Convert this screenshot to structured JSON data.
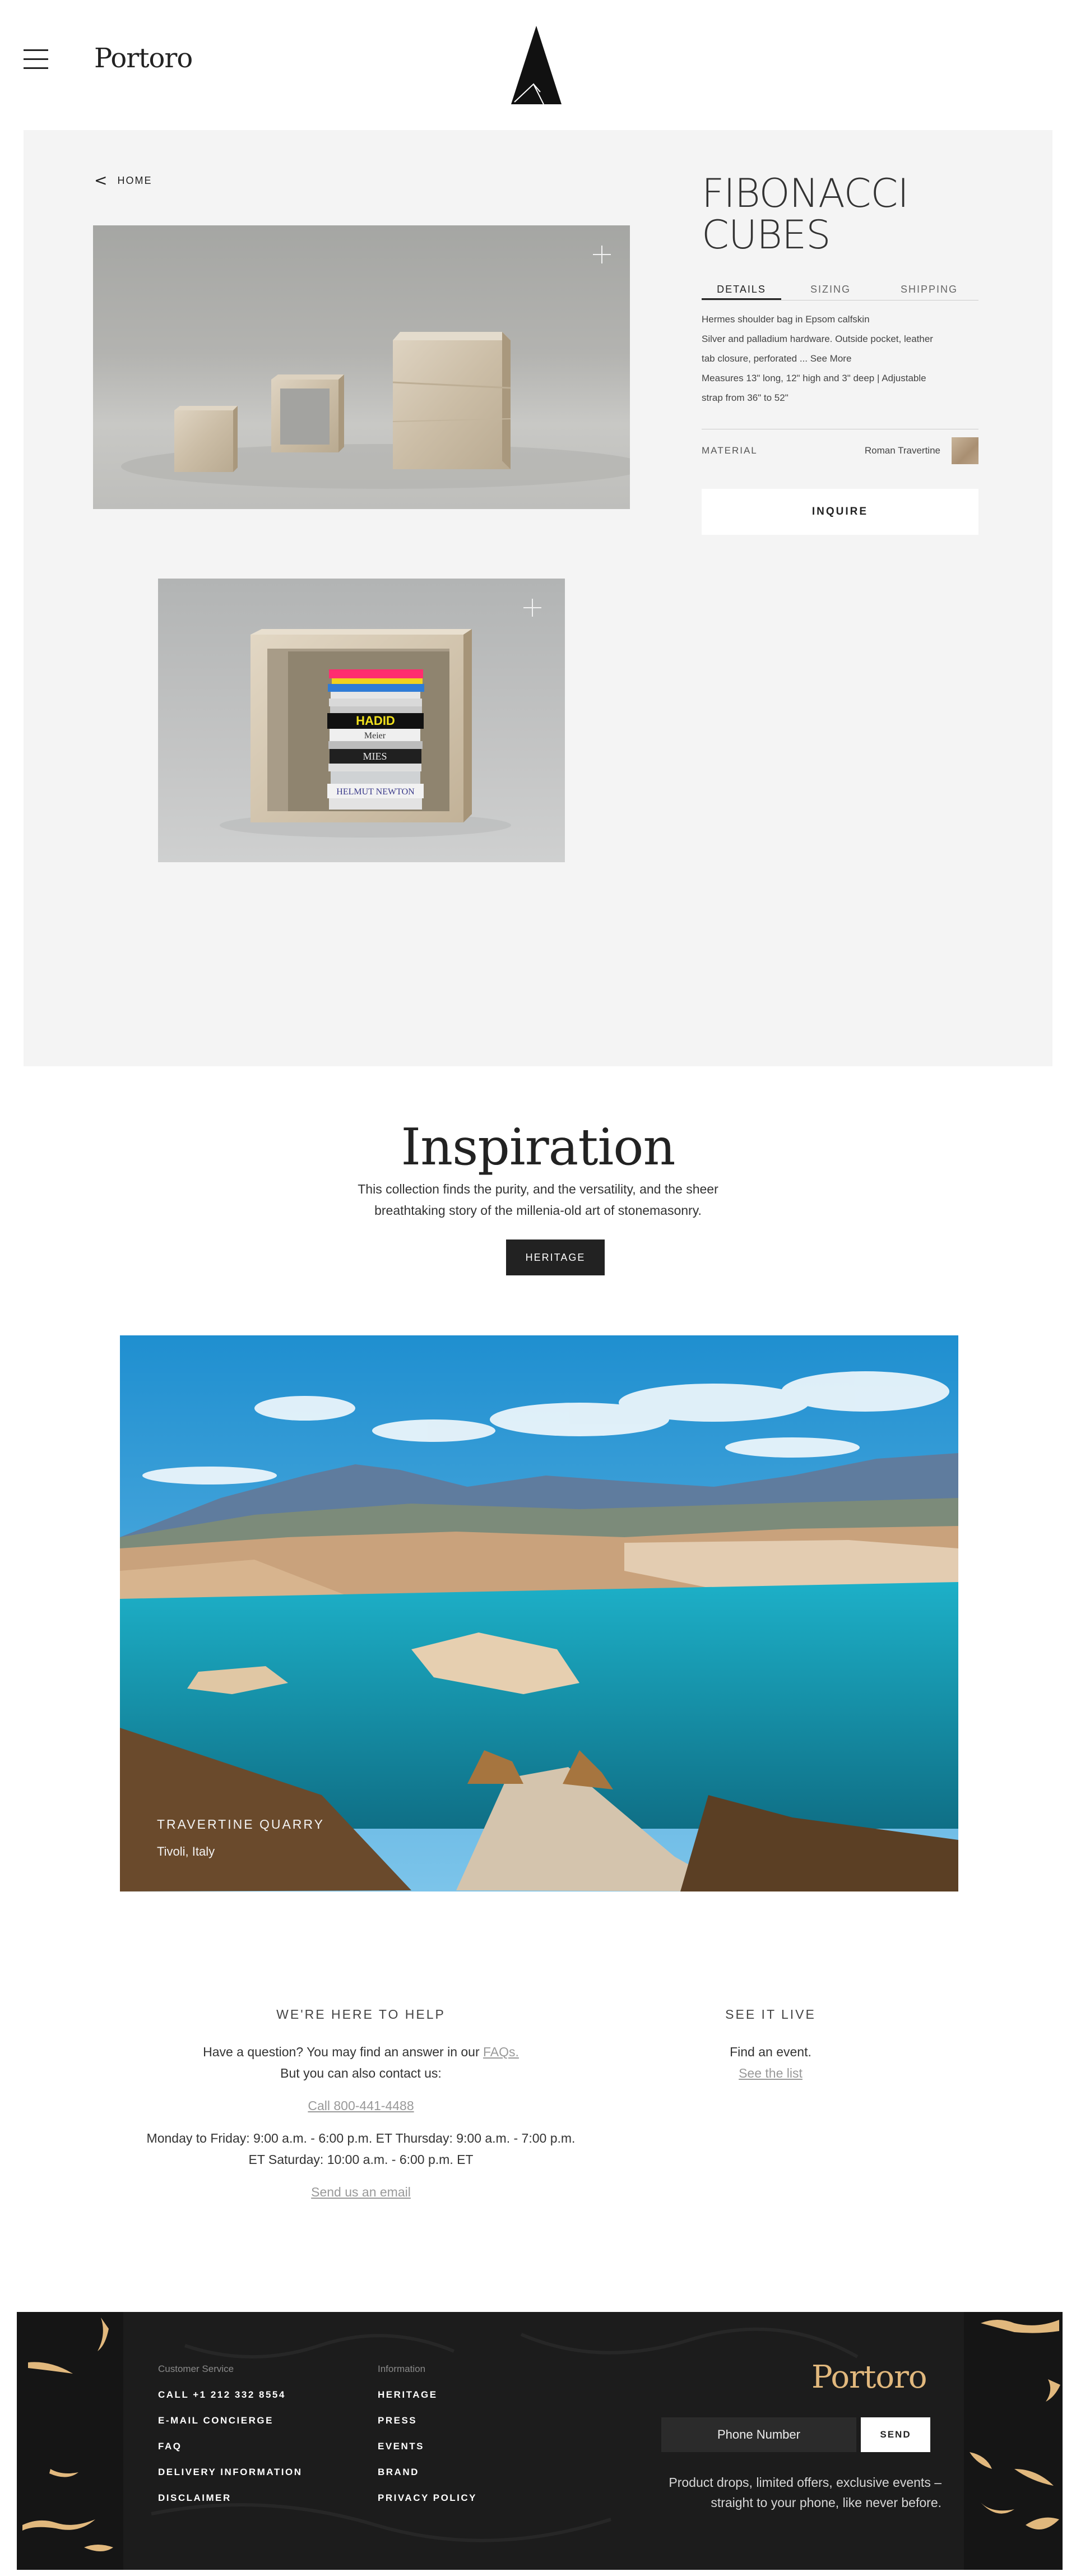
{
  "header": {
    "brand": "Portoro"
  },
  "product": {
    "back_label": "HOME",
    "title_line1": "FIBONACCI",
    "title_line2": "CUBES",
    "tabs": [
      {
        "label": "DETAILS"
      },
      {
        "label": "SIZING"
      },
      {
        "label": "SHIPPING"
      }
    ],
    "description": [
      "Hermes shoulder bag in Epsom calfskin",
      "Silver and palladium hardware. Outside pocket, leather",
      "tab closure, perforated ... See More",
      "Measures 13\" long, 12\" high and 3\" deep | Adjustable",
      "strap from 36\" to 52\""
    ],
    "material_label": "MATERIAL",
    "material_value": "Roman Travertine",
    "inquire_label": "INQUIRE",
    "book_spines": [
      "HADID",
      "Meier",
      "MIES",
      "HELMUT NEWTON"
    ]
  },
  "inspiration": {
    "title": "Inspiration",
    "line1": "This collection finds the purity, and the versatility, and the sheer",
    "line2": "breathtaking story of the millenia-old art of stonemasonry.",
    "button": "HERITAGE"
  },
  "quarry": {
    "caption_title": "TRAVERTINE QUARRY",
    "caption_location": "Tivoli, Italy"
  },
  "help": {
    "title": "WE'RE HERE TO HELP",
    "q_text": "Have a question? You may find an answer in our",
    "faq_link": "FAQs.",
    "contact_text": "But you can also contact us:",
    "call_link": "Call 800-441-4488",
    "hours1": "Monday to Friday: 9:00 a.m. - 6:00 p.m. ET Thursday: 9:00 a.m. - 7:00 p.m.",
    "hours2": "ET Saturday: 10:00 a.m. - 6:00 p.m. ET",
    "email_link": "Send us an email"
  },
  "live": {
    "title": "SEE IT LIVE",
    "text": "Find an event.",
    "link": "See the list"
  },
  "footer": {
    "cs_title": "Customer Service",
    "cs_links": [
      "CALL +1 212 332 8554",
      "E-MAIL CONCIERGE",
      "FAQ",
      "DELIVERY INFORMATION",
      "DISCLAIMER"
    ],
    "info_title": "Information",
    "info_links": [
      "HERITAGE",
      "PRESS",
      "EVENTS",
      "BRAND",
      "PRIVACY POLICY"
    ],
    "brand": "Portoro",
    "phone_placeholder": "Phone Number",
    "send_label": "SEND",
    "note_line1": "Product drops, limited offers, exclusive events –",
    "note_line2": "straight to your phone, like never before."
  },
  "colors": {
    "accent_gold": "#e1b87d",
    "footer_bg": "#1c1c1c",
    "button_dark": "#222222",
    "panel_bg": "#f4f4f4"
  }
}
